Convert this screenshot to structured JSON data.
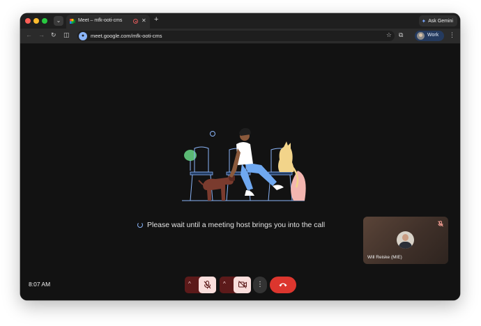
{
  "tab": {
    "title": "Meet – mfk-ooti-cms",
    "close_glyph": "✕",
    "new_tab_glyph": "+",
    "search_glyph": "⌄"
  },
  "header": {
    "ask_gemini_label": "Ask Gemini"
  },
  "toolbar": {
    "url": "meet.google.com/mfk-ooti-cms",
    "profile_label": "Work",
    "back_glyph": "←",
    "forward_glyph": "→",
    "reload_glyph": "↻",
    "reader_glyph": "◫",
    "bookmark_glyph": "☆",
    "extensions_glyph": "⧉",
    "menu_glyph": "⋮"
  },
  "meeting": {
    "wait_message": "Please wait until a meeting host brings you into the call",
    "self_name": "Will Reiske (MIE)",
    "clock": "8:07 AM"
  },
  "controls": {
    "caret_glyph": "^",
    "more_glyph": "⋮"
  },
  "icons": {
    "favicon": "google-meet-icon",
    "recording": "record-indicator-icon",
    "site_info": "site-info-icon",
    "mic": "mic-off-icon",
    "camera": "camera-off-icon",
    "leave": "hang-up-icon"
  },
  "colors": {
    "traffic_close": "#ff5f57",
    "traffic_min": "#febc2e",
    "traffic_max": "#28c840",
    "page_bg": "#121212",
    "control_red": "#5c1a1a",
    "toggle_pink": "#f9dedc",
    "leave_red": "#dc362e",
    "accent_blue": "#8ab4f8"
  }
}
